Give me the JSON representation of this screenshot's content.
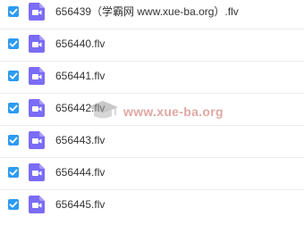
{
  "colors": {
    "checkbox": "#2d9bf0",
    "file_icon": "#7b6cf6",
    "text": "#333333",
    "watermark": "#c86058"
  },
  "files": [
    {
      "name": "656439（学霸网 www.xue-ba.org）.flv",
      "checked": true,
      "icon": "video-file-icon"
    },
    {
      "name": "656440.flv",
      "checked": true,
      "icon": "video-file-icon"
    },
    {
      "name": "656441.flv",
      "checked": true,
      "icon": "video-file-icon"
    },
    {
      "name": "656442.flv",
      "checked": true,
      "icon": "video-file-icon"
    },
    {
      "name": "656443.flv",
      "checked": true,
      "icon": "video-file-icon"
    },
    {
      "name": "656444.flv",
      "checked": true,
      "icon": "video-file-icon"
    },
    {
      "name": "656445.flv",
      "checked": true,
      "icon": "video-file-icon"
    }
  ],
  "watermark": {
    "text": "www.xue-ba.org",
    "icon": "graduation-cap-icon"
  }
}
